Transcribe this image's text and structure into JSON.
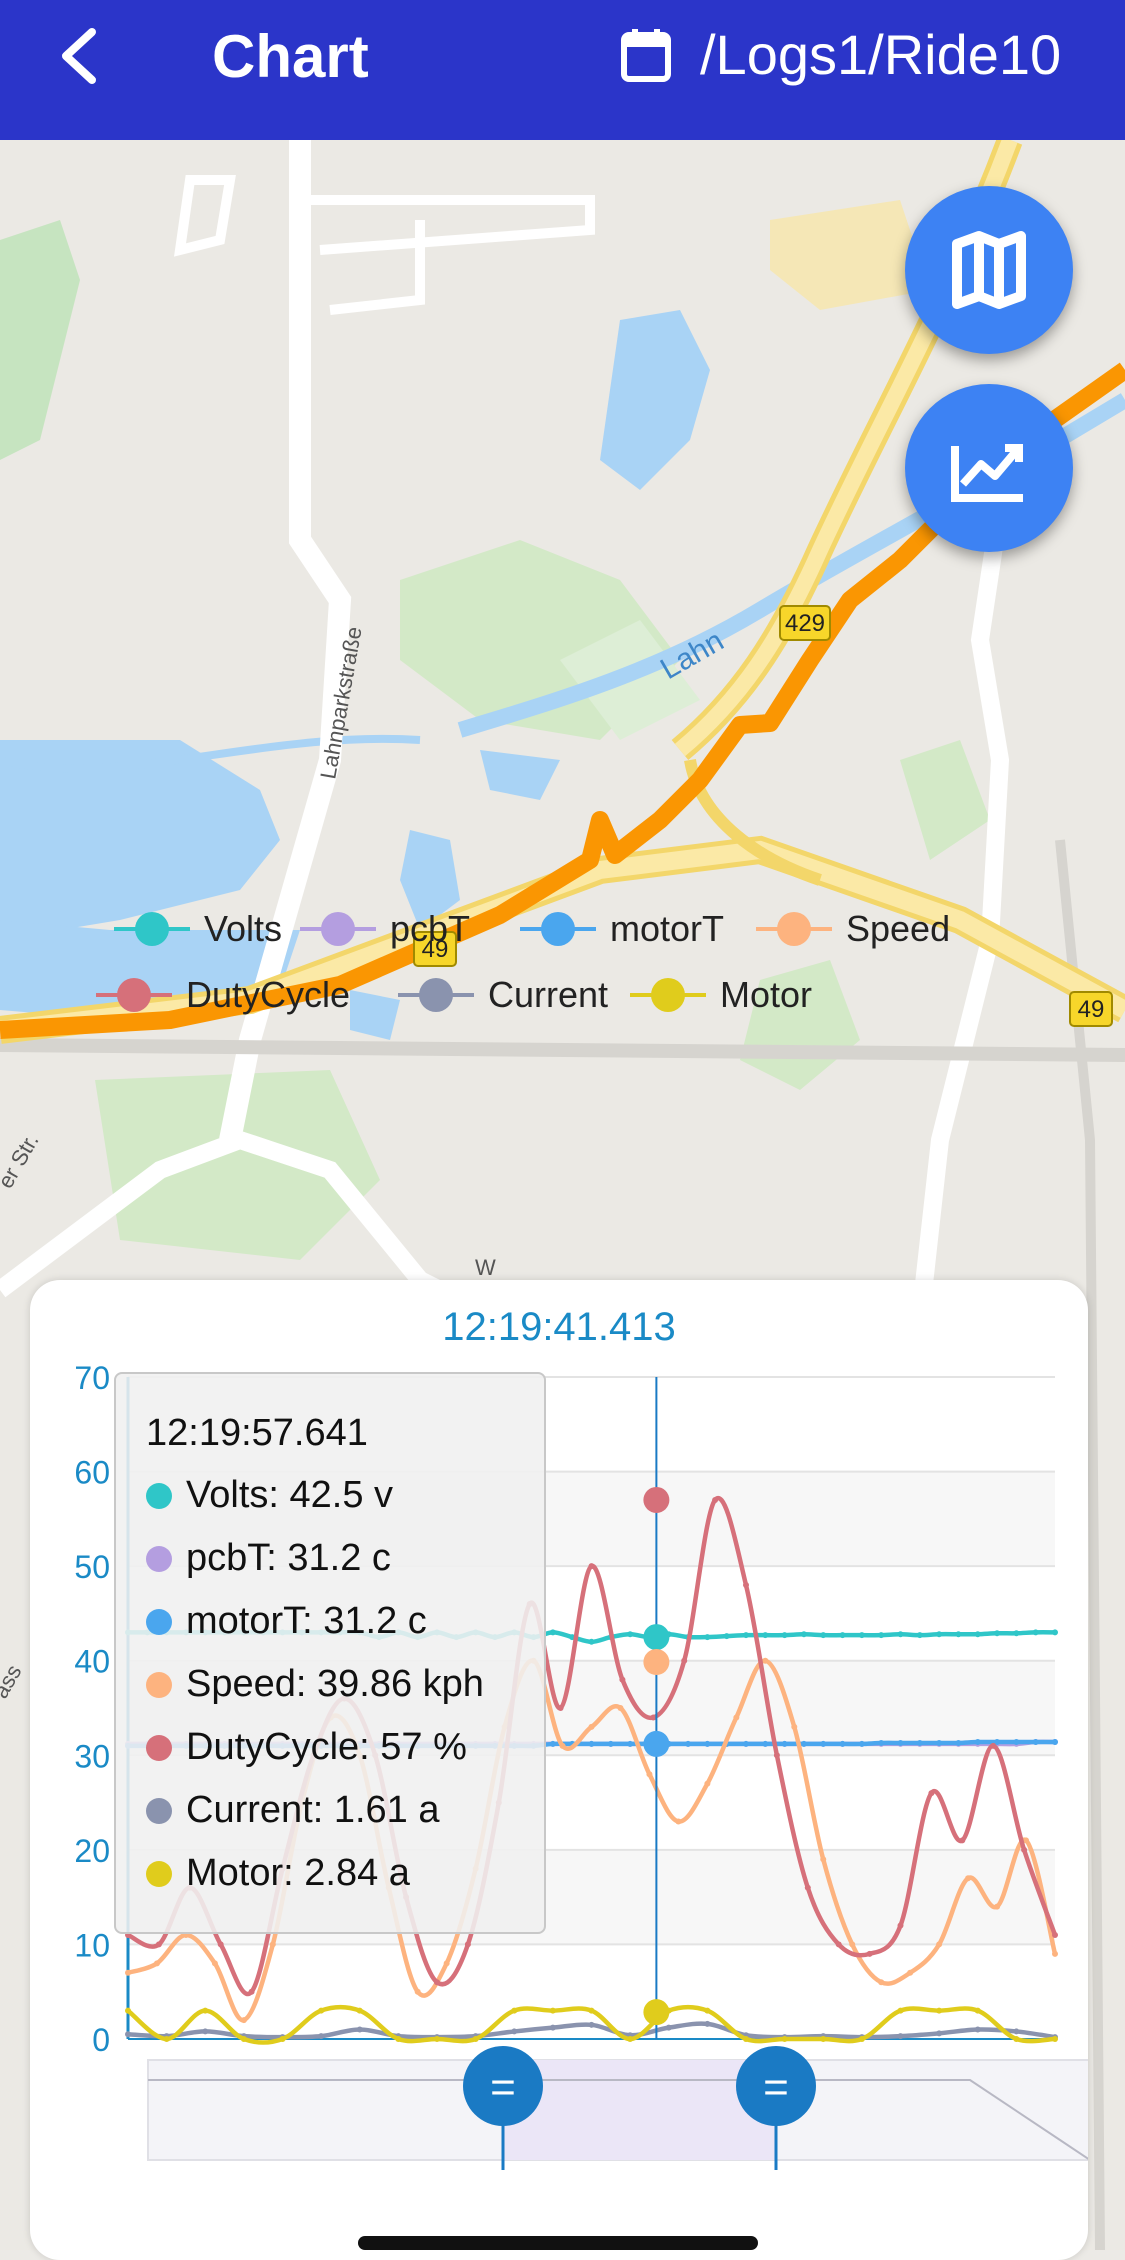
{
  "header": {
    "title": "Chart",
    "path": "/Logs1/Ride10"
  },
  "map": {
    "labels": {
      "river": "Lahn",
      "street_vertical": "Lahnparkstraße",
      "street_left": "er Str.",
      "street_left2": "ass",
      "road_429": "429",
      "road_49a": "49",
      "road_49b": "49",
      "road_bottom": "W"
    }
  },
  "fabs": {
    "map_icon": "map-icon",
    "chart_icon": "chart-line-icon"
  },
  "chart": {
    "title": "12:19:41.413",
    "tooltip": {
      "time": "12:19:57.641",
      "rows": [
        {
          "label": "Volts: 42.5 v",
          "color": "#2fc6c8"
        },
        {
          "label": "pcbT: 31.2 c",
          "color": "#b49ee0"
        },
        {
          "label": "motorT: 31.2 c",
          "color": "#4aa6ee"
        },
        {
          "label": "Speed: 39.86 kph",
          "color": "#fdb37f"
        },
        {
          "label": "DutyCycle: 57 %",
          "color": "#d6707a"
        },
        {
          "label": "Current: 1.61 a",
          "color": "#8a93ae"
        },
        {
          "label": "Motor: 2.84 a",
          "color": "#e0cc1c"
        }
      ]
    },
    "legend": [
      {
        "name": "Volts",
        "color": "#2fc6c8"
      },
      {
        "name": "pcbT",
        "color": "#b49ee0"
      },
      {
        "name": "motorT",
        "color": "#4aa6ee"
      },
      {
        "name": "Speed",
        "color": "#fdb37f"
      },
      {
        "name": "DutyCycle",
        "color": "#d6707a"
      },
      {
        "name": "Current",
        "color": "#8a93ae"
      },
      {
        "name": "Motor",
        "color": "#e0cc1c"
      }
    ],
    "slider_handle_label": "="
  },
  "chart_data": {
    "type": "line",
    "title": "12:19:41.413",
    "ylim": [
      0,
      70
    ],
    "yticks": [
      "0",
      "10",
      "20",
      "30",
      "40",
      "50",
      "60",
      "70"
    ],
    "grid": true,
    "legend_position": "bottom",
    "cursor_index": 30,
    "series": [
      {
        "name": "Volts",
        "color": "#2fc6c8",
        "values": [
          43,
          43,
          43,
          43,
          43,
          43,
          43,
          43,
          43,
          43,
          43,
          43,
          43,
          42.5,
          43,
          42.5,
          43,
          42.5,
          43,
          42.5,
          43,
          42.5,
          43,
          42.5,
          42,
          42.5,
          42.8,
          42.5,
          42.8,
          42.5,
          42.5,
          42.6,
          42.7,
          42.7,
          42.7,
          42.8,
          42.7,
          42.7,
          42.7,
          42.7,
          42.8,
          42.7,
          42.8,
          42.8,
          42.8,
          42.9,
          42.9,
          43,
          43
        ]
      },
      {
        "name": "pcbT",
        "color": "#b49ee0",
        "values": [
          31.2,
          31.2,
          31.2,
          31.2,
          31.2,
          31.2,
          31.2,
          31.2,
          31.2,
          31.2,
          31.2,
          31.2,
          31.2,
          31.2,
          31.2,
          31.2,
          31.2,
          31.2,
          31.2,
          31.2,
          31.2,
          31.2,
          31.2,
          31.2,
          31.2,
          31.2,
          31.2,
          31.2,
          31.2,
          31.2,
          31.2,
          31.2,
          31.2,
          31.2,
          31.2,
          31.2,
          31.2,
          31.2,
          31.2,
          31.2,
          31.2,
          31.2,
          31.2,
          31.2,
          31.2,
          31.2,
          31.2,
          31.4,
          31.4
        ]
      },
      {
        "name": "motorT",
        "color": "#4aa6ee",
        "values": [
          31,
          31,
          31,
          31,
          31,
          31,
          31,
          31,
          31,
          31,
          31,
          31,
          31,
          31,
          31,
          31,
          31,
          31,
          31,
          31,
          31,
          31,
          31.2,
          31.2,
          31.2,
          31.2,
          31.2,
          31.2,
          31.2,
          31.2,
          31.2,
          31.2,
          31.2,
          31.2,
          31.2,
          31.2,
          31.2,
          31.2,
          31.2,
          31.3,
          31.3,
          31.3,
          31.3,
          31.3,
          31.4,
          31.4,
          31.4,
          31.4,
          31.4
        ]
      },
      {
        "name": "Speed",
        "color": "#fdb37f",
        "values": [
          7,
          8,
          11,
          8,
          2,
          10,
          25,
          34,
          30,
          16,
          5,
          8,
          18,
          33,
          40,
          31,
          33,
          35,
          28,
          23,
          27,
          34,
          40,
          33,
          19,
          10,
          6,
          7,
          10,
          17,
          14,
          21,
          9
        ]
      },
      {
        "name": "DutyCycle",
        "color": "#d6707a",
        "values": [
          11,
          10,
          16,
          10,
          5,
          18,
          30,
          36,
          30,
          15,
          6,
          10,
          25,
          46,
          35,
          50,
          38,
          34,
          40,
          57,
          48,
          30,
          16,
          10,
          9,
          12,
          26,
          21,
          31,
          20,
          11
        ]
      },
      {
        "name": "Current",
        "color": "#8a93ae",
        "values": [
          0.5,
          0.3,
          0.8,
          0.3,
          0.2,
          0.3,
          1,
          0.3,
          0.2,
          0.3,
          0.8,
          1.2,
          1.5,
          0.4,
          1.2,
          1.6,
          0.4,
          0.2,
          0.3,
          0.2,
          0.3,
          0.6,
          1,
          0.8,
          0.2
        ]
      },
      {
        "name": "Motor",
        "color": "#e0cc1c",
        "values": [
          3,
          0,
          3,
          0,
          0,
          3,
          3,
          0,
          0,
          0,
          3,
          3,
          3,
          0,
          3,
          3,
          0,
          0,
          0,
          0,
          3,
          3,
          3,
          0,
          0
        ]
      }
    ]
  }
}
